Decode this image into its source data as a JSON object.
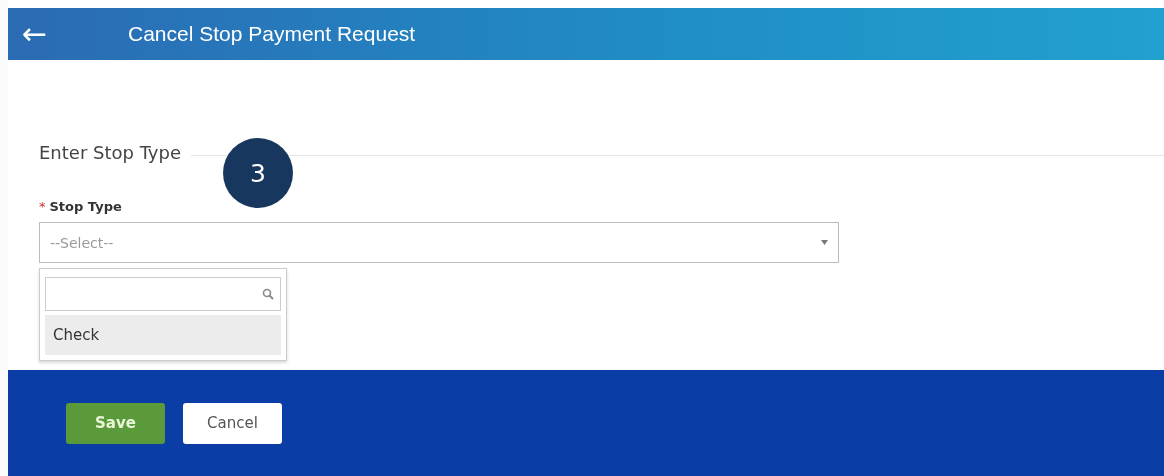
{
  "header": {
    "back_icon": "←",
    "title": "Cancel Stop Payment Request"
  },
  "section": {
    "title": "Enter Stop Type"
  },
  "step_badge": "3",
  "field": {
    "label": "Stop Type",
    "required_mark": "*",
    "placeholder": "--Select--"
  },
  "dropdown": {
    "options": [
      {
        "label": "Check",
        "selected": true
      }
    ]
  },
  "buttons": [
    {
      "label": "Save",
      "kind": "primary"
    },
    {
      "label": "Cancel",
      "kind": "secondary"
    }
  ]
}
